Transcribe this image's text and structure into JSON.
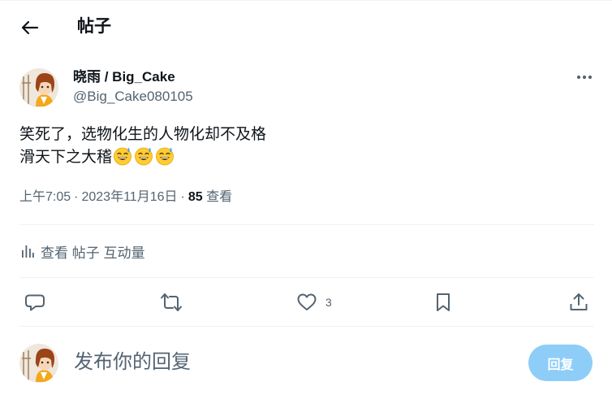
{
  "header": {
    "title": "帖子"
  },
  "post": {
    "display_name": "晓雨 / Big_Cake",
    "handle": "@Big_Cake080105",
    "text_line1": "笑死了，选物化生的人物化却不及格",
    "text_line2": "滑天下之大稽",
    "emoji_names": [
      "sweat-smile-emoji",
      "sweat-smile-emoji",
      "sweat-smile-emoji"
    ],
    "time": "上午7:05",
    "separator": "·",
    "date": "2023年11月16日",
    "views_count": "85",
    "views_label": "查看"
  },
  "engagements": {
    "label": "查看 帖子 互动量"
  },
  "actions": {
    "reply_icon": "speech-bubble-icon",
    "repost_icon": "repost-icon",
    "like_icon": "heart-icon",
    "like_count": "3",
    "bookmark_icon": "bookmark-icon",
    "share_icon": "share-icon"
  },
  "reply_box": {
    "placeholder": "发布你的回复",
    "button_label": "回复"
  },
  "colors": {
    "text_primary": "#0f1419",
    "text_secondary": "#536471",
    "divider": "#eff3f4",
    "reply_button": "#8ecdf8"
  }
}
